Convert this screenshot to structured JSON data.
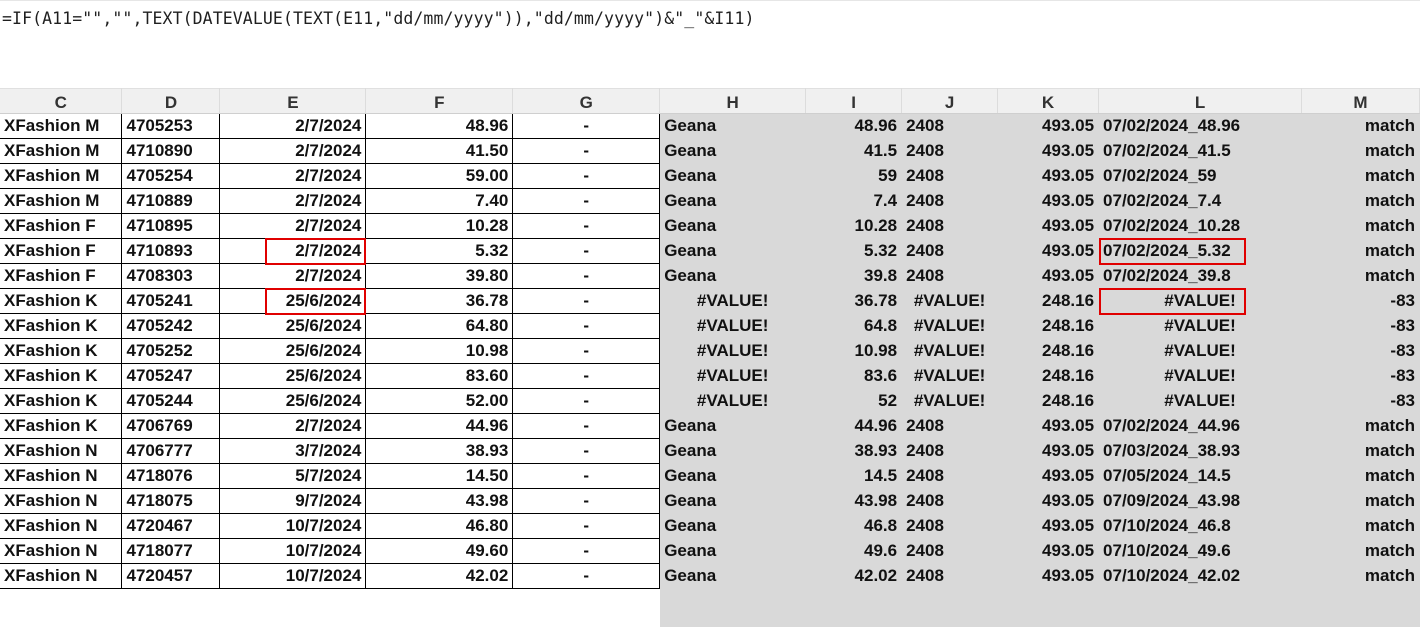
{
  "formula_bar": {
    "text": "=IF(A11=\"\",\"\",TEXT(DATEVALUE(TEXT(E11,\"dd/mm/yyyy\")),\"dd/mm/yyyy\")&\"_\"&I11)"
  },
  "columns": [
    "C",
    "D",
    "E",
    "F",
    "G",
    "H",
    "I",
    "J",
    "K",
    "L",
    "M"
  ],
  "rows": [
    {
      "c": "XFashion M",
      "d": "4705253",
      "e": "2/7/2024",
      "f": "48.96",
      "g": "-",
      "h": "Geana",
      "i": "48.96",
      "j": "2408",
      "k": "493.05",
      "l": "07/02/2024_48.96",
      "m": "match"
    },
    {
      "c": "XFashion M",
      "d": "4710890",
      "e": "2/7/2024",
      "f": "41.50",
      "g": "-",
      "h": "Geana",
      "i": "41.5",
      "j": "2408",
      "k": "493.05",
      "l": "07/02/2024_41.5",
      "m": "match"
    },
    {
      "c": "XFashion M",
      "d": "4705254",
      "e": "2/7/2024",
      "f": "59.00",
      "g": "-",
      "h": "Geana",
      "i": "59",
      "j": "2408",
      "k": "493.05",
      "l": "07/02/2024_59",
      "m": "match"
    },
    {
      "c": "XFashion M",
      "d": "4710889",
      "e": "2/7/2024",
      "f": "7.40",
      "g": "-",
      "h": "Geana",
      "i": "7.4",
      "j": "2408",
      "k": "493.05",
      "l": "07/02/2024_7.4",
      "m": "match"
    },
    {
      "c": "XFashion F",
      "d": "4710895",
      "e": "2/7/2024",
      "f": "10.28",
      "g": "-",
      "h": "Geana",
      "i": "10.28",
      "j": "2408",
      "k": "493.05",
      "l": "07/02/2024_10.28",
      "m": "match"
    },
    {
      "c": "XFashion F",
      "d": "4710893",
      "e": "2/7/2024",
      "f": "5.32",
      "g": "-",
      "h": "Geana",
      "i": "5.32",
      "j": "2408",
      "k": "493.05",
      "l": "07/02/2024_5.32",
      "m": "match"
    },
    {
      "c": "XFashion F",
      "d": "4708303",
      "e": "2/7/2024",
      "f": "39.80",
      "g": "-",
      "h": "Geana",
      "i": "39.8",
      "j": "2408",
      "k": "493.05",
      "l": "07/02/2024_39.8",
      "m": "match"
    },
    {
      "c": "XFashion K",
      "d": "4705241",
      "e": "25/6/2024",
      "f": "36.78",
      "g": "-",
      "h": "#VALUE!",
      "i": "36.78",
      "j": "#VALUE!",
      "k": "248.16",
      "l": "#VALUE!",
      "m": "-83"
    },
    {
      "c": "XFashion K",
      "d": "4705242",
      "e": "25/6/2024",
      "f": "64.80",
      "g": "-",
      "h": "#VALUE!",
      "i": "64.8",
      "j": "#VALUE!",
      "k": "248.16",
      "l": "#VALUE!",
      "m": "-83"
    },
    {
      "c": "XFashion K",
      "d": "4705252",
      "e": "25/6/2024",
      "f": "10.98",
      "g": "-",
      "h": "#VALUE!",
      "i": "10.98",
      "j": "#VALUE!",
      "k": "248.16",
      "l": "#VALUE!",
      "m": "-83"
    },
    {
      "c": "XFashion K",
      "d": "4705247",
      "e": "25/6/2024",
      "f": "83.60",
      "g": "-",
      "h": "#VALUE!",
      "i": "83.6",
      "j": "#VALUE!",
      "k": "248.16",
      "l": "#VALUE!",
      "m": "-83"
    },
    {
      "c": "XFashion K",
      "d": "4705244",
      "e": "25/6/2024",
      "f": "52.00",
      "g": "-",
      "h": "#VALUE!",
      "i": "52",
      "j": "#VALUE!",
      "k": "248.16",
      "l": "#VALUE!",
      "m": "-83"
    },
    {
      "c": "XFashion K",
      "d": "4706769",
      "e": "2/7/2024",
      "f": "44.96",
      "g": "-",
      "h": "Geana",
      "i": "44.96",
      "j": "2408",
      "k": "493.05",
      "l": "07/02/2024_44.96",
      "m": "match"
    },
    {
      "c": "XFashion N",
      "d": "4706777",
      "e": "3/7/2024",
      "f": "38.93",
      "g": "-",
      "h": "Geana",
      "i": "38.93",
      "j": "2408",
      "k": "493.05",
      "l": "07/03/2024_38.93",
      "m": "match"
    },
    {
      "c": "XFashion N",
      "d": "4718076",
      "e": "5/7/2024",
      "f": "14.50",
      "g": "-",
      "h": "Geana",
      "i": "14.5",
      "j": "2408",
      "k": "493.05",
      "l": "07/05/2024_14.5",
      "m": "match"
    },
    {
      "c": "XFashion N",
      "d": "4718075",
      "e": "9/7/2024",
      "f": "43.98",
      "g": "-",
      "h": "Geana",
      "i": "43.98",
      "j": "2408",
      "k": "493.05",
      "l": "07/09/2024_43.98",
      "m": "match"
    },
    {
      "c": "XFashion N",
      "d": "4720467",
      "e": "10/7/2024",
      "f": "46.80",
      "g": "-",
      "h": "Geana",
      "i": "46.8",
      "j": "2408",
      "k": "493.05",
      "l": "07/10/2024_46.8",
      "m": "match"
    },
    {
      "c": "XFashion N",
      "d": "4718077",
      "e": "10/7/2024",
      "f": "49.60",
      "g": "-",
      "h": "Geana",
      "i": "49.6",
      "j": "2408",
      "k": "493.05",
      "l": "07/10/2024_49.6",
      "m": "match"
    },
    {
      "c": "XFashion N",
      "d": "4720457",
      "e": "10/7/2024",
      "f": "42.02",
      "g": "-",
      "h": "Geana",
      "i": "42.02",
      "j": "2408",
      "k": "493.05",
      "l": "07/10/2024_42.02",
      "m": "match"
    }
  ],
  "highlights": [
    {
      "row": 5,
      "col": "e"
    },
    {
      "row": 5,
      "col": "l"
    },
    {
      "row": 7,
      "col": "e"
    },
    {
      "row": 7,
      "col": "l"
    }
  ],
  "colors": {
    "highlight_border": "#e00000",
    "shaded_region": "#d9d9d9",
    "header_bg": "#f0f0f0"
  }
}
